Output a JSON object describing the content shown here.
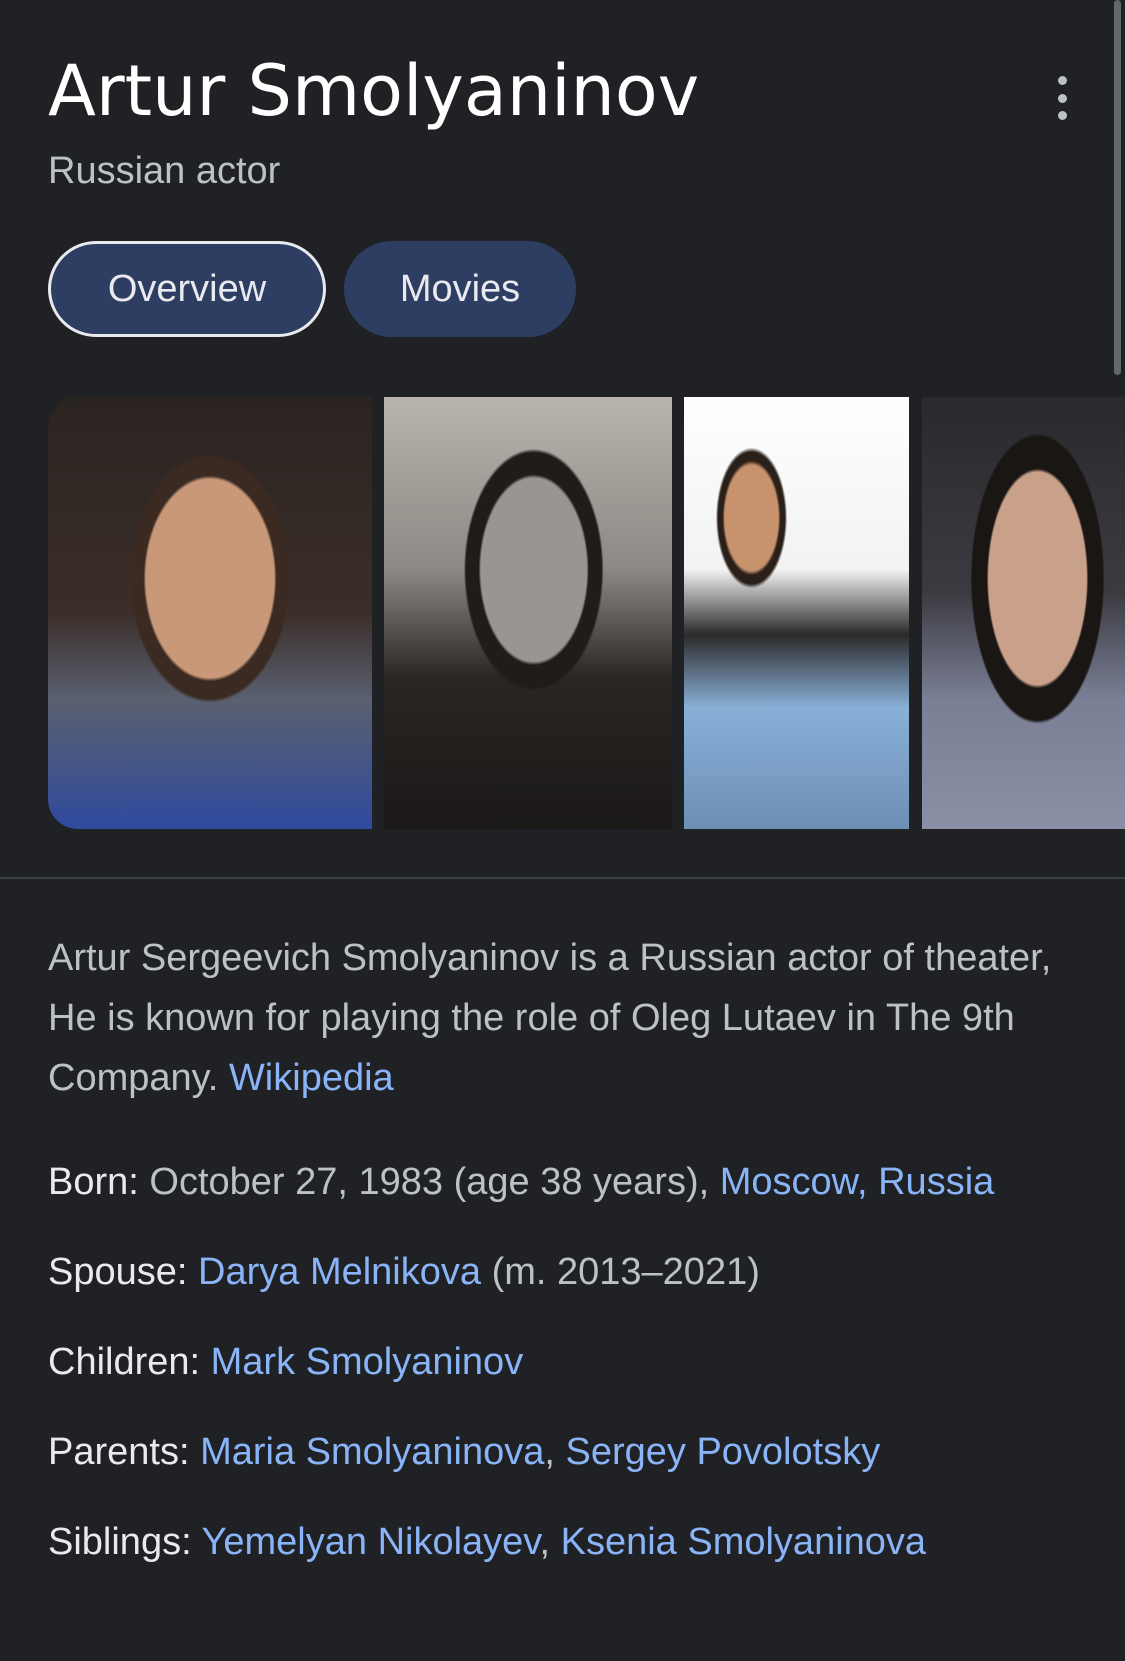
{
  "header": {
    "title": "Artur Smolyaninov",
    "subtitle": "Russian actor"
  },
  "tabs": [
    {
      "label": "Overview",
      "active": true
    },
    {
      "label": "Movies",
      "active": false
    }
  ],
  "gallery": {
    "images": [
      "portrait photo 1",
      "portrait photo 2",
      "portrait photo 3",
      "portrait photo 4"
    ]
  },
  "description": {
    "text": "Artur Sergeevich Smolyaninov is a Russian actor of theater, He is known for playing the role of Oleg Lutaev in The 9th Company.",
    "source_link": "Wikipedia"
  },
  "facts": {
    "born": {
      "label": "Born:",
      "value": "October 27, 1983 (age 38 years),",
      "link": "Moscow, Russia"
    },
    "spouse": {
      "label": "Spouse:",
      "link": "Darya Melnikova",
      "extra": "(m. 2013–2021)"
    },
    "children": {
      "label": "Children:",
      "link": "Mark Smolyaninov"
    },
    "parents": {
      "label": "Parents:",
      "link1": "Maria Smolyaninova",
      "sep": ",",
      "link2": "Sergey Povolotsky"
    },
    "siblings": {
      "label": "Siblings:",
      "link1": "Yemelyan Nikolayev",
      "sep": ",",
      "link2": "Ksenia Smolyaninova"
    }
  },
  "colors": {
    "background": "#202124",
    "link": "#8ab4f8",
    "tab_bg": "#2e3e63"
  },
  "icons": {
    "menu": "more-vert-icon"
  }
}
